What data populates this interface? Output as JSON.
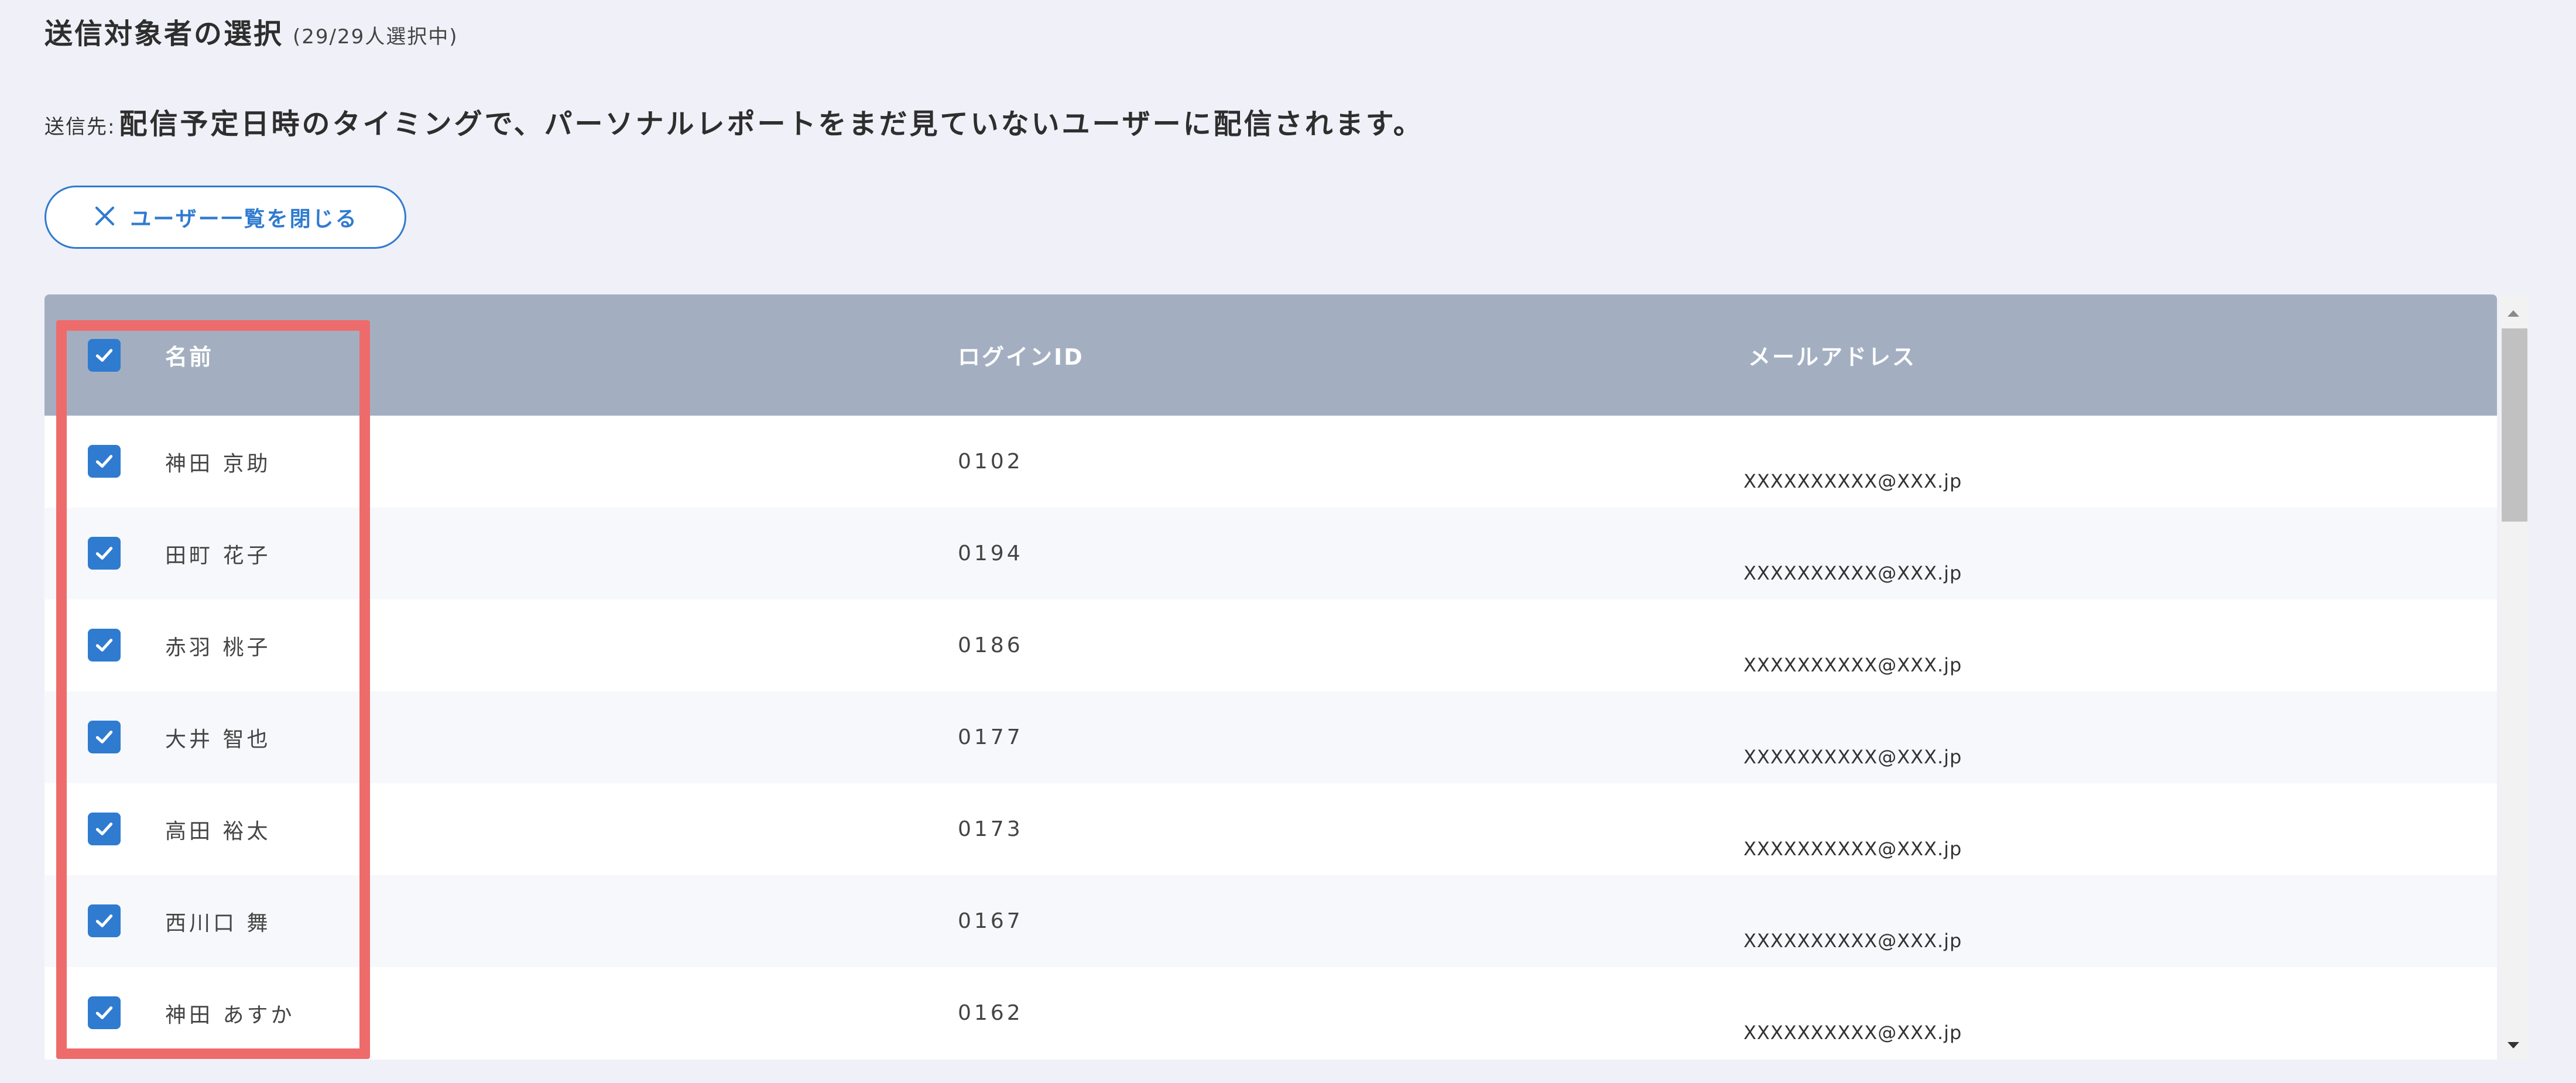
{
  "header": {
    "title": "送信対象者の選択",
    "selection_count": "(29/29人選択中)"
  },
  "destination": {
    "label": "送信先:",
    "text": "配信予定日時のタイミングで、パーソナルレポートをまだ見ていないユーザーに配信されます。"
  },
  "close_button": {
    "label": "ユーザー一覧を閉じる",
    "icon": "close-icon"
  },
  "table": {
    "columns": {
      "name": "名前",
      "login_id": "ログインID",
      "email": "メールアドレス"
    },
    "select_all_checked": true,
    "rows": [
      {
        "checked": true,
        "name": "神田 京助",
        "login_id": "0102",
        "email": "XXXXXXXXXX@XXX.jp"
      },
      {
        "checked": true,
        "name": "田町 花子",
        "login_id": "0194",
        "email": "XXXXXXXXXX@XXX.jp"
      },
      {
        "checked": true,
        "name": "赤羽 桃子",
        "login_id": "0186",
        "email": "XXXXXXXXXX@XXX.jp"
      },
      {
        "checked": true,
        "name": "大井 智也",
        "login_id": "0177",
        "email": "XXXXXXXXXX@XXX.jp"
      },
      {
        "checked": true,
        "name": "高田 裕太",
        "login_id": "0173",
        "email": "XXXXXXXXXX@XXX.jp"
      },
      {
        "checked": true,
        "name": "西川口 舞",
        "login_id": "0167",
        "email": "XXXXXXXXXX@XXX.jp"
      },
      {
        "checked": true,
        "name": "神田 あすか",
        "login_id": "0162",
        "email": "XXXXXXXXXX@XXX.jp"
      }
    ]
  },
  "colors": {
    "accent": "#2f7bd0",
    "table_header": "#a3afc1",
    "highlight": "#ee6b6b",
    "background": "#f0f0f8"
  }
}
